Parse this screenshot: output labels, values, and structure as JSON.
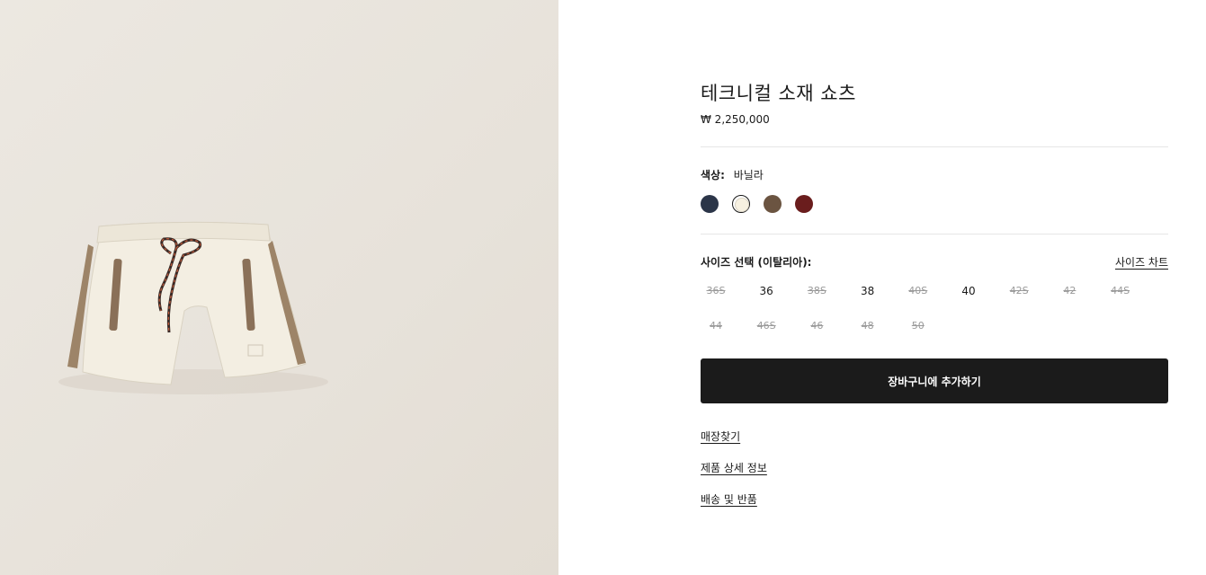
{
  "product": {
    "title": "테크니컬 소재 쇼츠",
    "price": "₩ 2,250,000"
  },
  "color": {
    "label": "색상:",
    "selected_name": "바닐라",
    "swatches": [
      {
        "color": "#2b3548",
        "selected": false
      },
      {
        "color": "#f7f1e1",
        "selected": true
      },
      {
        "color": "#6b5441",
        "selected": false
      },
      {
        "color": "#6a1d1d",
        "selected": false
      }
    ]
  },
  "size": {
    "label": "사이즈 선택 (이탈리아):",
    "chart_link": "사이즈 차트",
    "options": [
      {
        "label": "36S",
        "available": false
      },
      {
        "label": "36",
        "available": true
      },
      {
        "label": "38S",
        "available": false
      },
      {
        "label": "38",
        "available": true
      },
      {
        "label": "40S",
        "available": false
      },
      {
        "label": "40",
        "available": true
      },
      {
        "label": "42S",
        "available": false
      },
      {
        "label": "42",
        "available": false
      },
      {
        "label": "44S",
        "available": false
      },
      {
        "label": "44",
        "available": false
      },
      {
        "label": "46S",
        "available": false
      },
      {
        "label": "46",
        "available": false
      },
      {
        "label": "48",
        "available": false
      },
      {
        "label": "50",
        "available": false
      }
    ]
  },
  "cart_button": "장바구니에 추가하기",
  "links": {
    "store": "매장찾기",
    "details": "제품 상세 정보",
    "shipping": "배송 및 반품"
  },
  "image": {
    "subject": "vanilla technical-fabric shorts with drawstring"
  }
}
